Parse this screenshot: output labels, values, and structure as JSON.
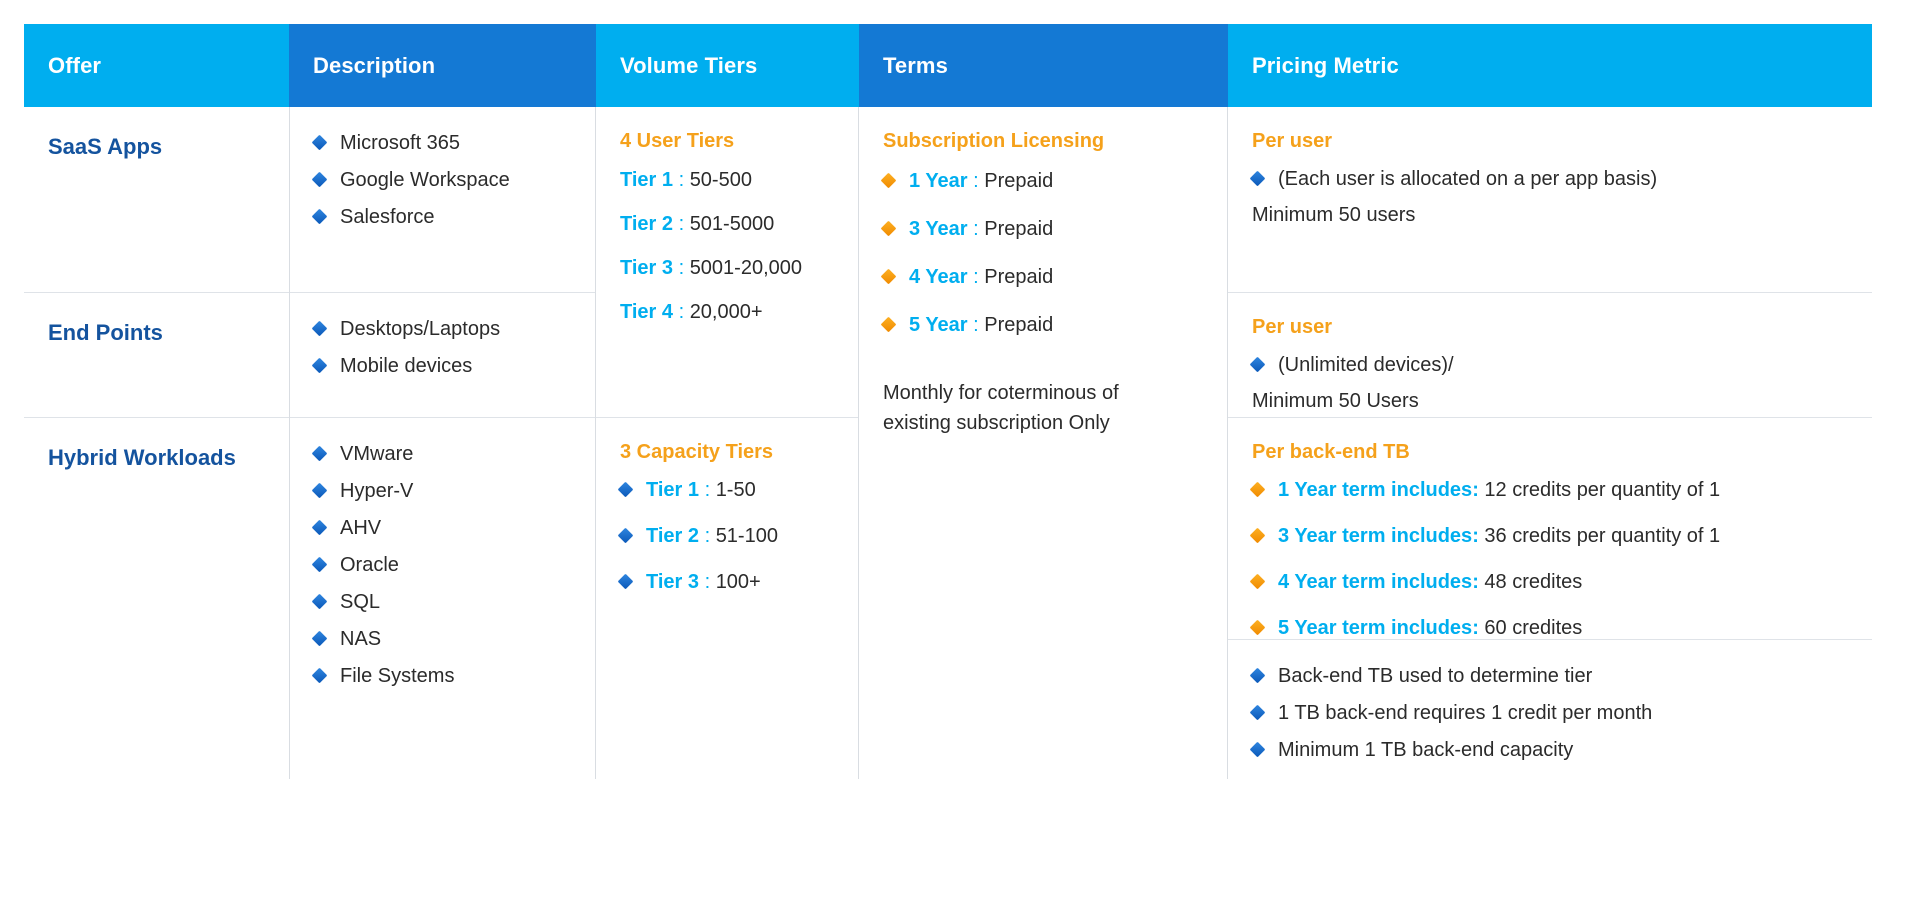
{
  "colors": {
    "header_light": "#00AEEF",
    "header_dark": "#1479D4",
    "offer_label": "#14539E",
    "accent_orange": "#F5A11B",
    "accent_cyan": "#00AEEF",
    "body_text": "#2B2B2B",
    "bullet_blue": "#1479D4",
    "bullet_orange": "#F5A11B"
  },
  "header": {
    "offer": "Offer",
    "description": "Description",
    "volume_tiers": "Volume Tiers",
    "terms": "Terms",
    "pricing_metric": "Pricing Metric"
  },
  "offers": {
    "saas": "SaaS Apps",
    "endpoints": "End Points",
    "hybrid": "Hybrid Workloads"
  },
  "description": {
    "saas": [
      "Microsoft 365",
      "Google Workspace",
      "Salesforce"
    ],
    "endpoints": [
      "Desktops/Laptops",
      "Mobile devices"
    ],
    "hybrid": [
      "VMware",
      "Hyper-V",
      "AHV",
      "Oracle",
      "SQL",
      "NAS",
      "File Systems"
    ]
  },
  "volume_tiers": {
    "user": {
      "heading": "4 User Tiers",
      "rows": [
        {
          "label": "Tier 1",
          "sep": ":",
          "value": "50-500"
        },
        {
          "label": "Tier 2",
          "sep": ":",
          "value": "501-5000"
        },
        {
          "label": "Tier 3",
          "sep": ":",
          "value": "5001-20,000"
        },
        {
          "label": "Tier 4",
          "sep": ":",
          "value": "20,000+"
        }
      ]
    },
    "capacity": {
      "heading": "3 Capacity Tiers",
      "rows": [
        {
          "label": "Tier 1",
          "sep": ":",
          "value": "1-50"
        },
        {
          "label": "Tier 2",
          "sep": ":",
          "value": "51-100"
        },
        {
          "label": "Tier 3",
          "sep": ":",
          "value": "100+"
        }
      ]
    }
  },
  "terms": {
    "heading": "Subscription Licensing",
    "rows": [
      {
        "label": "1 Year",
        "sep": ":",
        "value": "Prepaid"
      },
      {
        "label": "3 Year",
        "sep": ":",
        "value": "Prepaid"
      },
      {
        "label": "4 Year",
        "sep": ":",
        "value": "Prepaid"
      },
      {
        "label": "5 Year",
        "sep": ":",
        "value": "Prepaid"
      }
    ],
    "note_line1": "Monthly for coterminous of",
    "note_line2": "existing subscription Only"
  },
  "pricing_metric": {
    "saas": {
      "heading": "Per user",
      "bullet": "(Each user is allocated on a per app basis)",
      "note": "Minimum 50 users"
    },
    "endpoints": {
      "heading": "Per user",
      "bullet": "(Unlimited devices)/",
      "note": "Minimum 50 Users"
    },
    "hybrid": {
      "heading": "Per back-end TB",
      "terms": [
        {
          "label": "1 Year term includes",
          "sep": ":",
          "value": "12 credits per quantity of 1"
        },
        {
          "label": "3 Year term includes",
          "sep": ":",
          "value": "36 credits per quantity of 1"
        },
        {
          "label": "4 Year term includes",
          "sep": ":",
          "value": "48 credites"
        },
        {
          "label": "5 Year term includes",
          "sep": ":",
          "value": "60 credites"
        }
      ],
      "notes": [
        "Back-end TB used to determine tier",
        "1 TB back-end requires 1 credit per month",
        "Minimum 1 TB back-end capacity"
      ]
    }
  }
}
